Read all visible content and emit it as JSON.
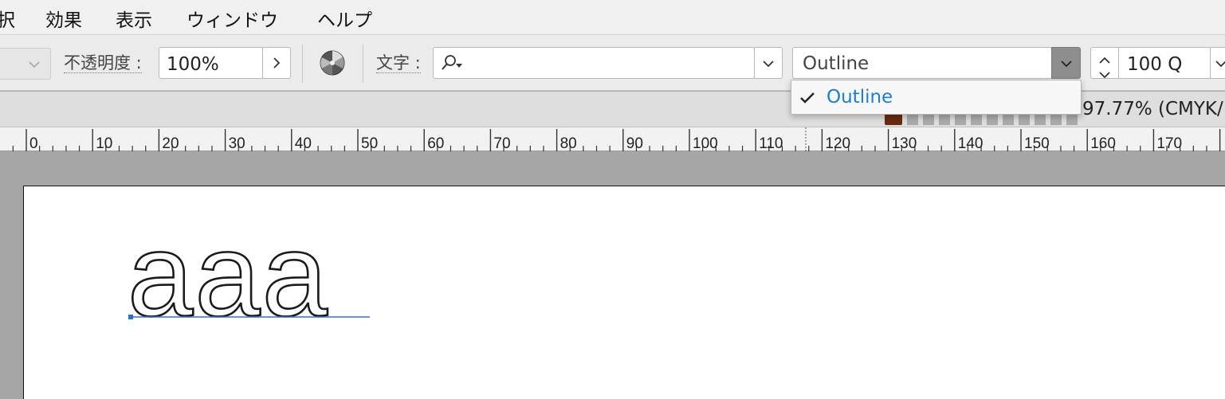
{
  "menubar": {
    "items": [
      "択",
      "効果",
      "表示",
      "ウィンドウ",
      "ヘルプ"
    ]
  },
  "control_bar": {
    "opacity_label": "不透明度 :",
    "opacity_value": "100%",
    "char_label": "文字 :",
    "font_style_value": "Outline",
    "font_size_value": "100 Q"
  },
  "popup": {
    "items": [
      {
        "label": "Outline",
        "selected": true
      }
    ]
  },
  "docbar": {
    "zoom_text": "97.77% (CMYK/"
  },
  "ruler": {
    "labels": [
      "0",
      "10",
      "20",
      "30",
      "40",
      "50",
      "60",
      "70",
      "80",
      "90",
      "100",
      "110",
      "120",
      "130",
      "140",
      "150",
      "160",
      "170"
    ]
  },
  "document": {
    "text": "aaa",
    "text_style": "outline"
  },
  "colors": {
    "accent": "#1a7ed6",
    "selection_line": "#2f6fd8",
    "page_border": "#111111"
  }
}
